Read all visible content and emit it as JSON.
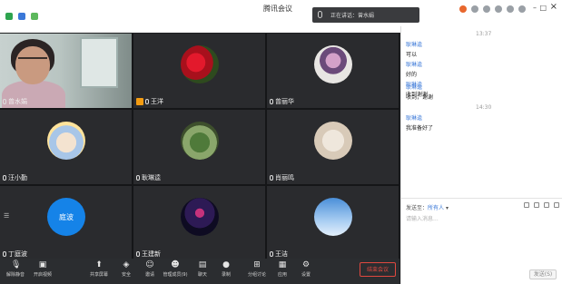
{
  "window": {
    "title": "腾讯会议",
    "speaking_toast": "正在讲话：曾水娟"
  },
  "participants": [
    {
      "name": "曾水娟",
      "avatar": "camera-feed"
    },
    {
      "name": "王洋",
      "avatar": "red-rose",
      "host": true
    },
    {
      "name": "曾丽华",
      "avatar": "flower-bouquet"
    },
    {
      "name": "汪小勤",
      "avatar": "cartoon-girl"
    },
    {
      "name": "耿琳逵",
      "avatar": "tree-scene"
    },
    {
      "name": "肖丽鸣",
      "avatar": "sketch-portrait"
    },
    {
      "name": "丁庭波",
      "avatar": "text-avatar",
      "avatar_text": "庭波"
    },
    {
      "name": "王建新",
      "avatar": "tower-night"
    },
    {
      "name": "王洁",
      "avatar": "blue-sky"
    }
  ],
  "chat": {
    "time_1": "13:37",
    "time_2": "14:30",
    "messages": [
      {
        "sender": "耿琳逵",
        "text": "可以"
      },
      {
        "sender": "耿琳逵",
        "text": "好的"
      },
      {
        "sender": "耿琳逵",
        "text": "收到谢谢"
      },
      {
        "sender": "耿琳逵",
        "text": "收到，谢谢"
      },
      {
        "sender": "耿琳逵",
        "text": "我准备好了"
      }
    ],
    "send_to_label": "发送至：",
    "send_to_value": "所有人",
    "placeholder": "请输入消息...",
    "send_button": "发送(S)"
  },
  "controls": {
    "mute": "解除静音",
    "video": "开启视频",
    "share": "共享屏幕",
    "security": "安全",
    "invite": "邀请",
    "members": "管理成员(9)",
    "chat": "聊天",
    "record": "录制",
    "breakout": "分组讨论",
    "apps": "应用",
    "settings": "设置",
    "end": "结束会议"
  },
  "colors": {
    "accent": "#1583e8",
    "end_red": "#e0483f",
    "host_badge": "#f39c12"
  }
}
